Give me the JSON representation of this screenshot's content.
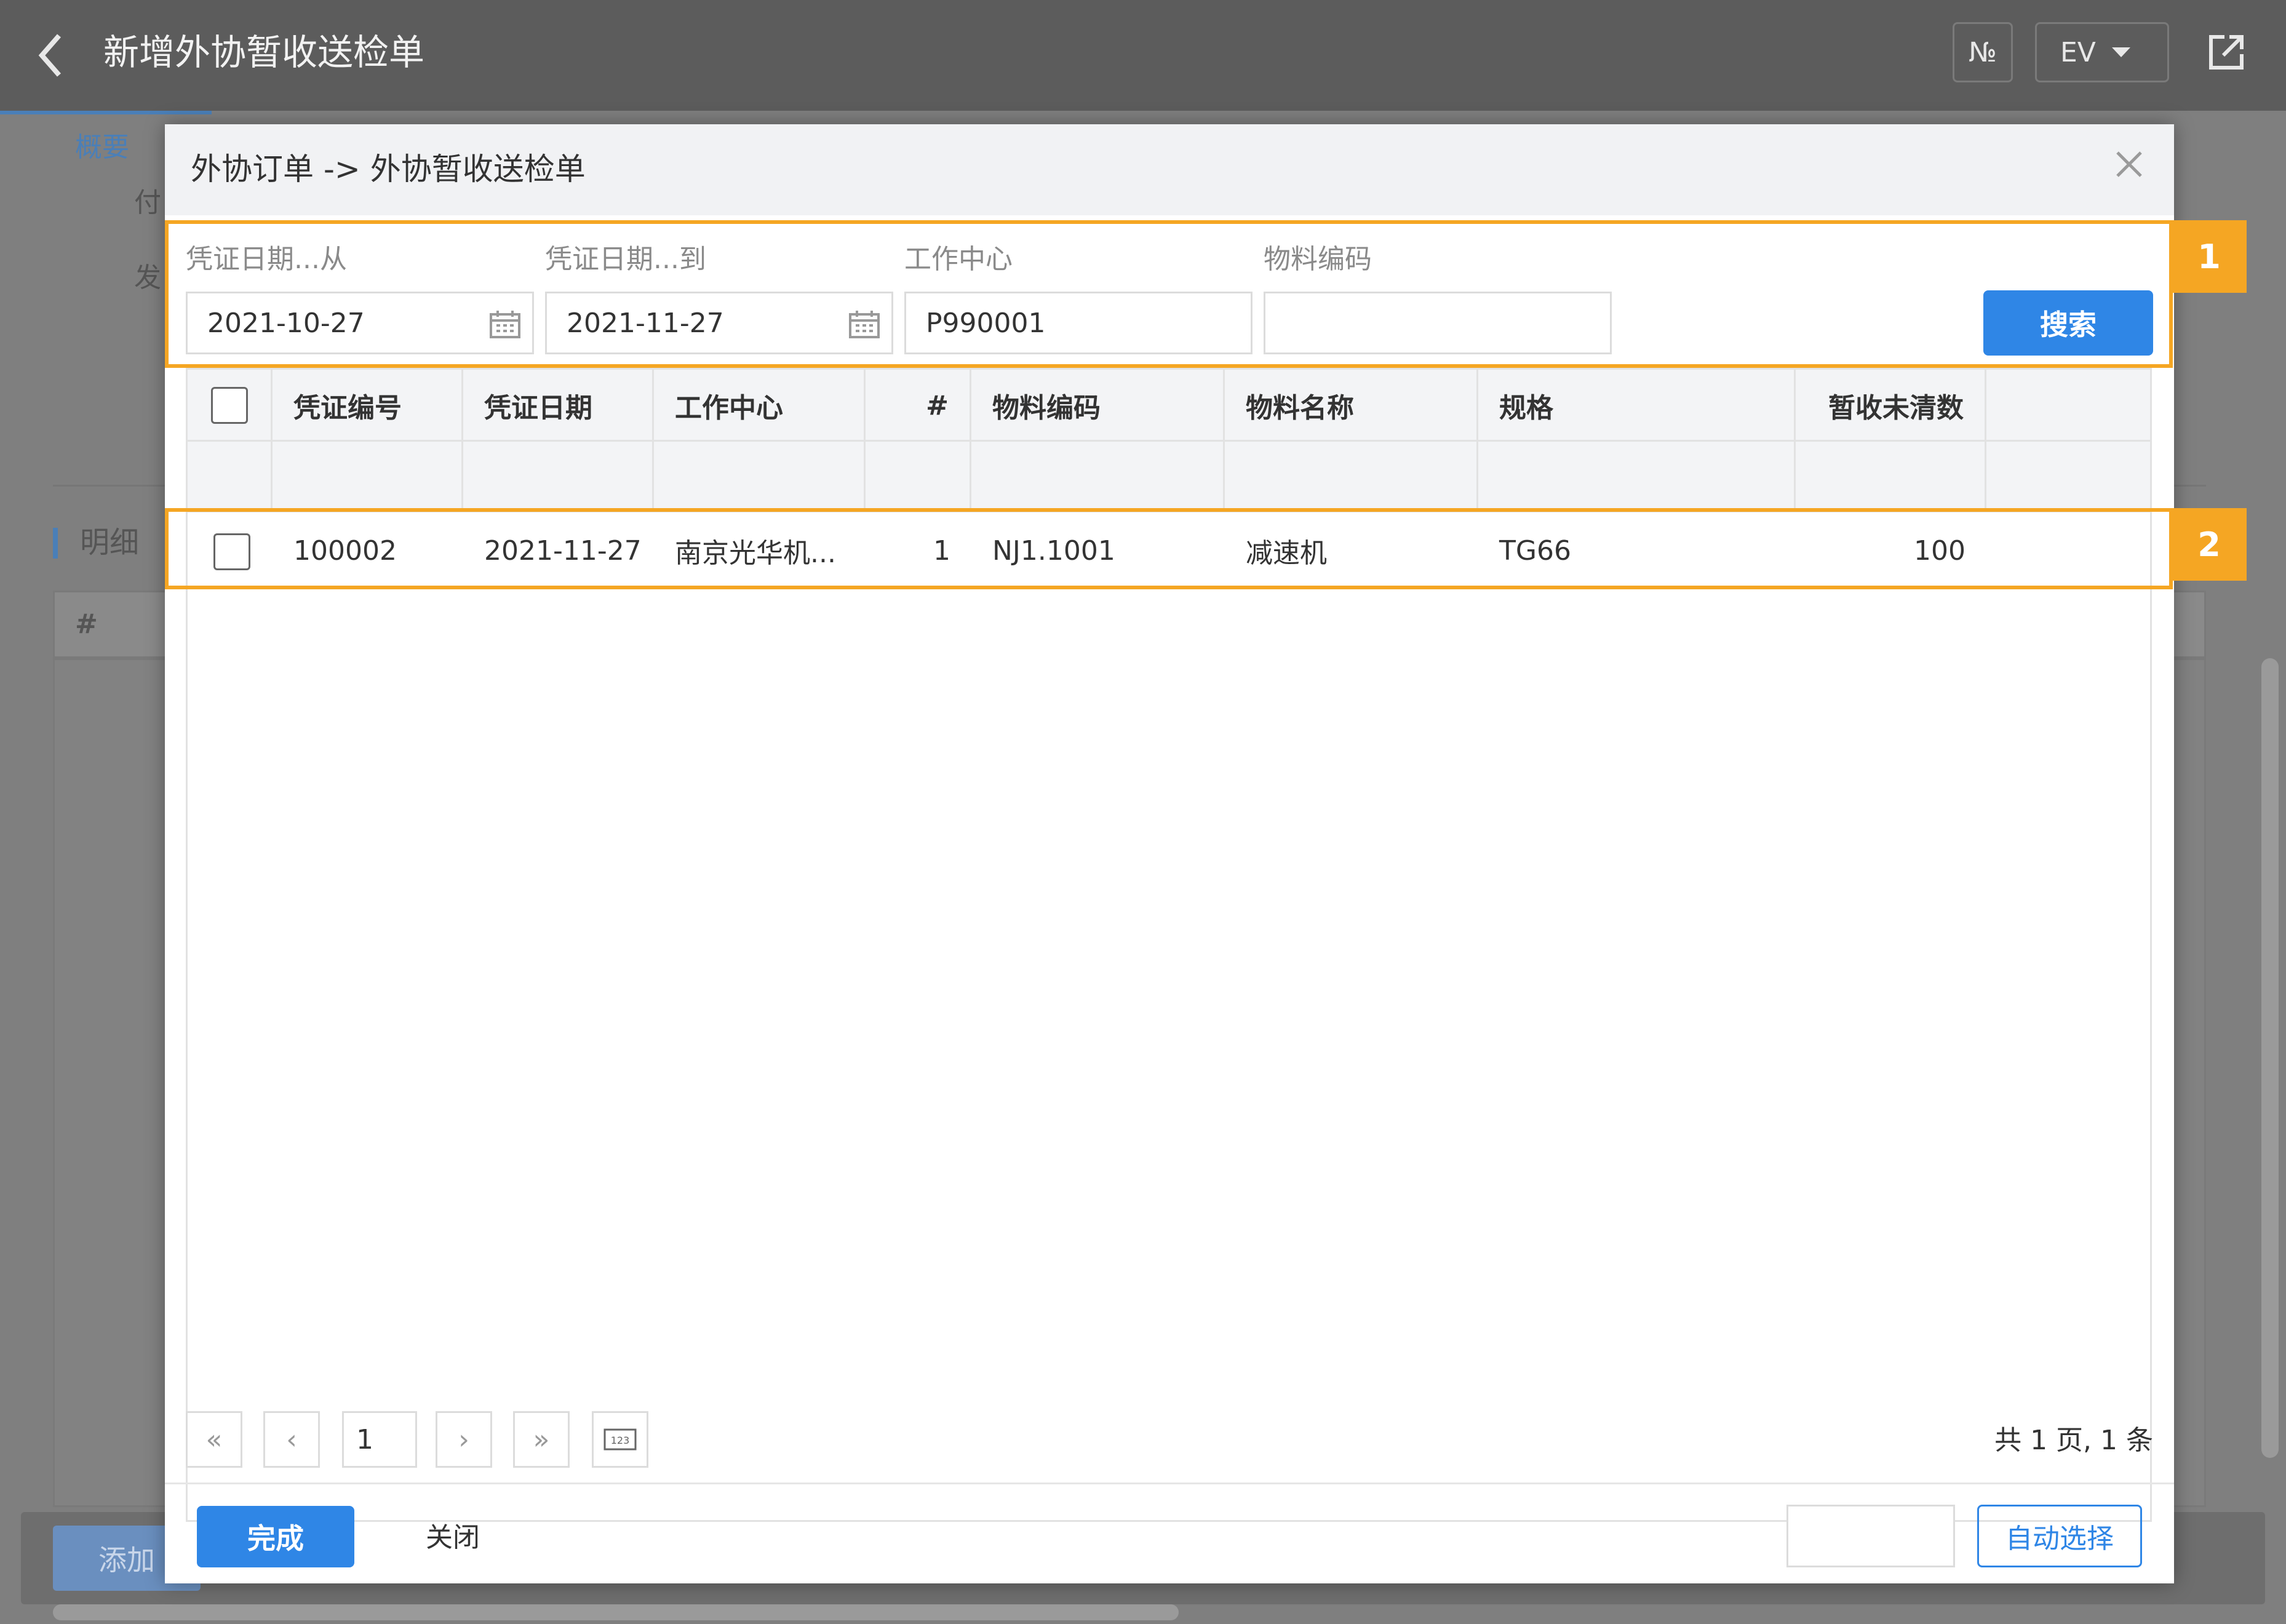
{
  "header": {
    "title": "新增外协暂收送检单",
    "btn_no": "№",
    "btn_ev": "EV",
    "icons": [
      "back-chevron-icon",
      "share-icon",
      "caret-down-icon"
    ]
  },
  "background": {
    "tab_label": "概要",
    "field1_label": "付",
    "field2_label": "发",
    "section_label": "明细",
    "grid_hash": "#",
    "add_button": "添加"
  },
  "dialog": {
    "title": "外协订单 -> 外协暂收送检单",
    "filters": {
      "date_from_label": "凭证日期...从",
      "date_from_value": "2021-10-27",
      "date_to_label": "凭证日期...到",
      "date_to_value": "2021-11-27",
      "work_center_label": "工作中心",
      "work_center_value": "P990001",
      "material_code_label": "物料编码",
      "material_code_value": "",
      "search_button": "搜索"
    },
    "columns": [
      "凭证编号",
      "凭证日期",
      "工作中心",
      "#",
      "物料编码",
      "物料名称",
      "规格",
      "暂收未清数"
    ],
    "rows": [
      {
        "voucher_no": "100002",
        "voucher_date": "2021-11-27",
        "work_center": "南京光华机...",
        "line": "1",
        "material_code": "NJ1.1001",
        "material_name": "减速机",
        "spec": "TG66",
        "open_qty": "100"
      }
    ],
    "pager": {
      "page_input": "1",
      "summary": "共 1 页, 1 条"
    },
    "footer": {
      "done_button": "完成",
      "close_button": "关闭",
      "auto_select_input": "",
      "auto_select_button": "自动选择"
    },
    "annotations": {
      "badge1": "1",
      "badge2": "2"
    }
  },
  "colors": {
    "accent": "#2f86e6",
    "highlight": "#f5a623",
    "header_bg": "#5c5c5c"
  }
}
